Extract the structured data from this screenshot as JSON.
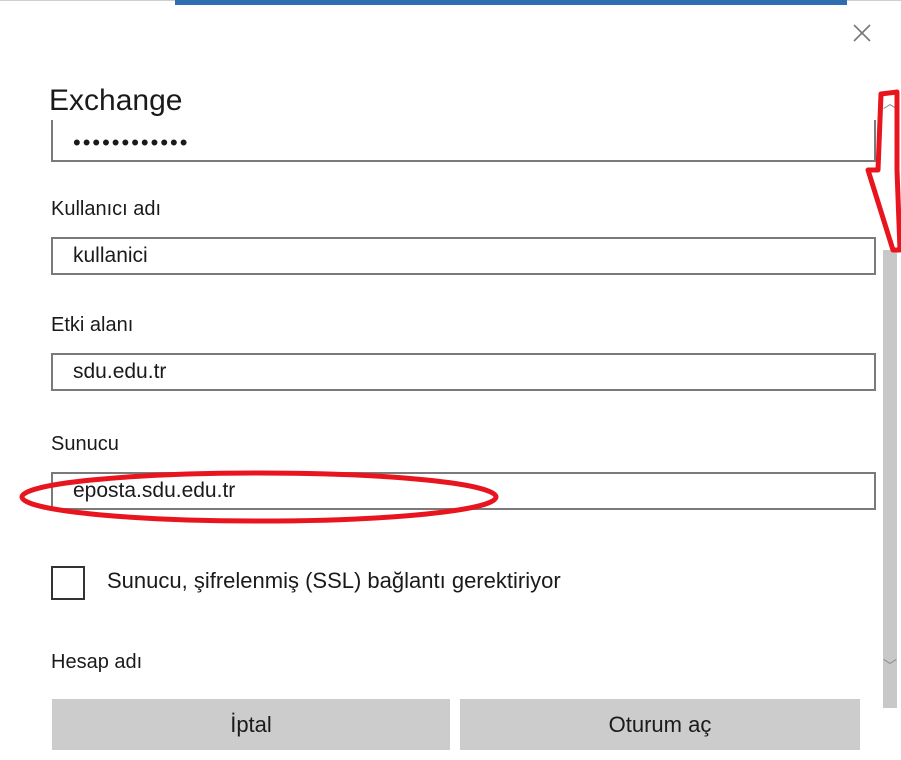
{
  "dialog": {
    "title": "Exchange",
    "password_value": "••••••••••••",
    "username_label": "Kullanıcı adı",
    "username_value": "kullanici",
    "domain_label": "Etki alanı",
    "domain_value": "sdu.edu.tr",
    "server_label": "Sunucu",
    "server_value": "eposta.sdu.edu.tr",
    "ssl_label": "Sunucu, şifrelenmiş (SSL) bağlantı gerektiriyor",
    "ssl_checked": false,
    "account_name_label": "Hesap adı"
  },
  "buttons": {
    "cancel_label": "İptal",
    "signin_label": "Oturum aç"
  },
  "icons": {
    "close": "close-icon",
    "scroll_up": "chevron-up-icon",
    "scroll_down": "chevron-down-icon"
  },
  "colors": {
    "annotation_red": "#e8151f",
    "button_gray": "#cccccc",
    "window_blue": "#2d6db0"
  }
}
